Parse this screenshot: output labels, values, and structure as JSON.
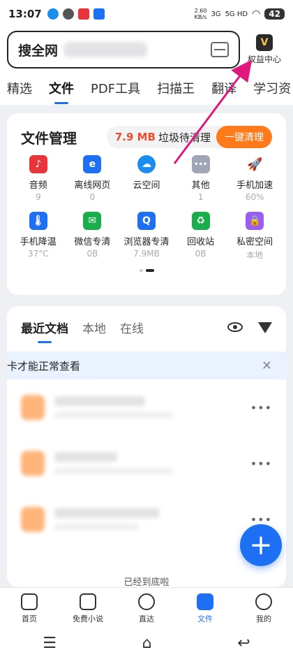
{
  "status": {
    "time": "13:07",
    "net_speed": "2.60\nKB/s",
    "signal1": "3G",
    "signal2": "5G HD",
    "battery": "42"
  },
  "search": {
    "brand": "搜全网"
  },
  "vip": {
    "label": "权益中心",
    "icon": "V"
  },
  "tabs": [
    "精选",
    "文件",
    "PDF工具",
    "扫描王",
    "翻译",
    "学习资"
  ],
  "file_manager": {
    "title": "文件管理",
    "junk_size": "7.9 MB",
    "junk_text": "垃圾待清理",
    "clean_button": "一键清理",
    "items": [
      {
        "label": "音频",
        "sub": "9",
        "color": "#e8353b",
        "icon": "♪"
      },
      {
        "label": "离线网页",
        "sub": "0",
        "color": "#1d6ff3",
        "icon": "e"
      },
      {
        "label": "云空间",
        "sub": "",
        "color": "#1c8df0",
        "icon": "☁"
      },
      {
        "label": "其他",
        "sub": "1",
        "color": "#a0a6b5",
        "icon": "•••"
      },
      {
        "label": "手机加速",
        "sub": "60%",
        "color": "#ffffff",
        "icon": "🚀"
      },
      {
        "label": "手机降温",
        "sub": "37°C",
        "color": "#1d6ff3",
        "icon": "🌡"
      },
      {
        "label": "微信专清",
        "sub": "0B",
        "color": "#1aad4c",
        "icon": "✉"
      },
      {
        "label": "浏览器专清",
        "sub": "7.9MB",
        "color": "#1d6ff3",
        "icon": "Q"
      },
      {
        "label": "回收站",
        "sub": "0B",
        "color": "#1aad4c",
        "icon": "♻"
      },
      {
        "label": "私密空间",
        "sub": "本地",
        "color": "#9b5cf0",
        "icon": "🔒"
      }
    ]
  },
  "recent": {
    "tabs": [
      "最近文档",
      "本地",
      "在线"
    ],
    "notice": "卡才能正常查看",
    "end_text": "已经到底啦"
  },
  "bottom_nav": [
    "首页",
    "免费小说",
    "直达",
    "文件",
    "我的"
  ],
  "system_nav": [
    "☰",
    "⌂",
    "↩"
  ]
}
